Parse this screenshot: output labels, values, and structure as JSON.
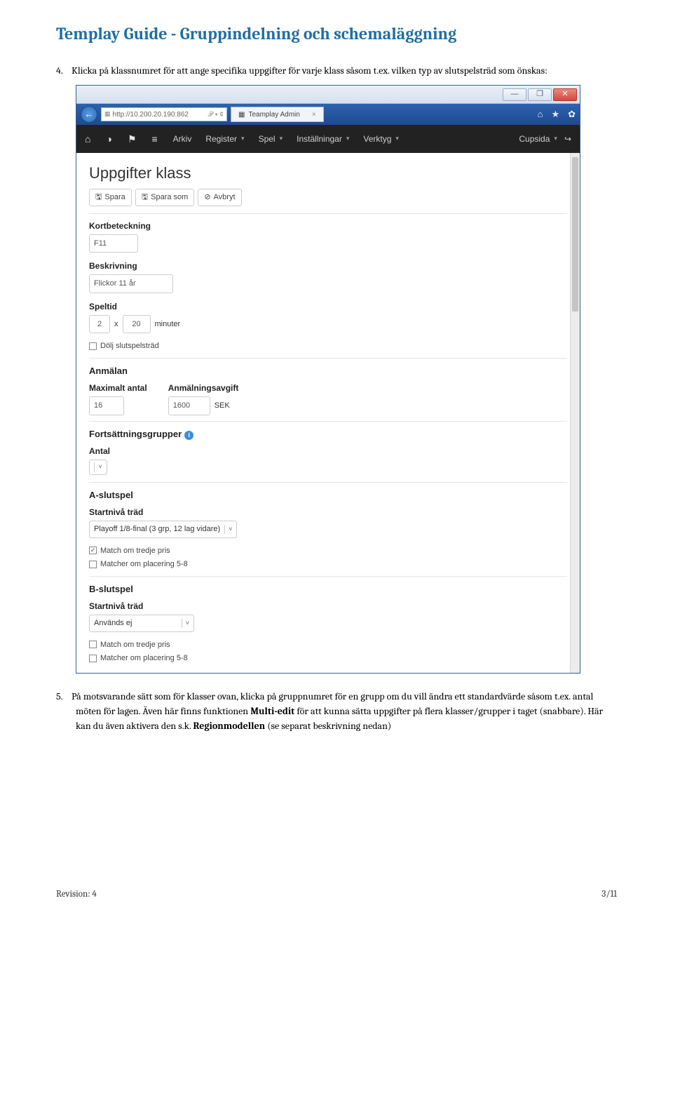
{
  "doc": {
    "title": "Templay Guide - Gruppindelning och schemaläggning",
    "step4_num": "4.",
    "step4_text": "Klicka på klassnumret för att ange specifika uppgifter för varje klass såsom t.ex. vilken typ av slutspelsträd som önskas:",
    "step5_num": "5.",
    "step5_a": "På motsvarande sätt som för klasser ovan, klicka på gruppnumret för en grupp om du vill ändra ett standardvärde såsom t.ex. antal möten för lagen. Även här finns funktionen ",
    "step5_b": "Multi-edit",
    "step5_c": " för att kunna sätta uppgifter på flera klasser/grupper i taget (snabbare). Här kan du även aktivera den s.k. ",
    "step5_d": "Regionmodellen",
    "step5_e": " (se separat beskrivning nedan)",
    "revision": "Revision: 4",
    "page": "3/11"
  },
  "win": {
    "min": "—",
    "max": "❐",
    "close": "✕"
  },
  "ie": {
    "url": "http://10.200.20.190:862",
    "search_sep": "𝒫 ▾ ¢",
    "tab": "Teamplay Admin",
    "tabx": "×",
    "ic_home": "⌂",
    "ic_star": "★",
    "ic_gear": "✿"
  },
  "nav": {
    "arkiv": "Arkiv",
    "register": "Register",
    "spel": "Spel",
    "installningar": "Inställningar",
    "verktyg": "Verktyg",
    "cupsida": "Cupsida",
    "exit_ic": "↪"
  },
  "form": {
    "page_title": "Uppgifter klass",
    "btn_spara": "Spara",
    "btn_spara_som": "Spara som",
    "btn_avbryt": "Avbryt",
    "kortbeteckning_lb": "Kortbeteckning",
    "kortbeteckning_val": "F11",
    "beskrivning_lb": "Beskrivning",
    "beskrivning_val": "Flickor 11 år",
    "speltid_lb": "Speltid",
    "speltid_a": "2",
    "speltid_x": "x",
    "speltid_b": "20",
    "speltid_unit": "minuter",
    "dolj": "Dölj slutspelsträd",
    "anmalan_h": "Anmälan",
    "max_lb": "Maximalt antal",
    "max_val": "16",
    "avg_lb": "Anmälningsavgift",
    "avg_val": "1600",
    "avg_cur": "SEK",
    "fort_h": "Fortsättningsgrupper",
    "antal_lb": "Antal",
    "aslut_h": "A-slutspel",
    "start_lb": "Startnivå träd",
    "a_sel": "Playoff 1/8-final (3 grp, 12 lag vidare)",
    "chk_tredje": "Match om tredje pris",
    "chk_58": "Matcher om placering 5-8",
    "bslut_h": "B-slutspel",
    "b_sel": "Används ej"
  }
}
